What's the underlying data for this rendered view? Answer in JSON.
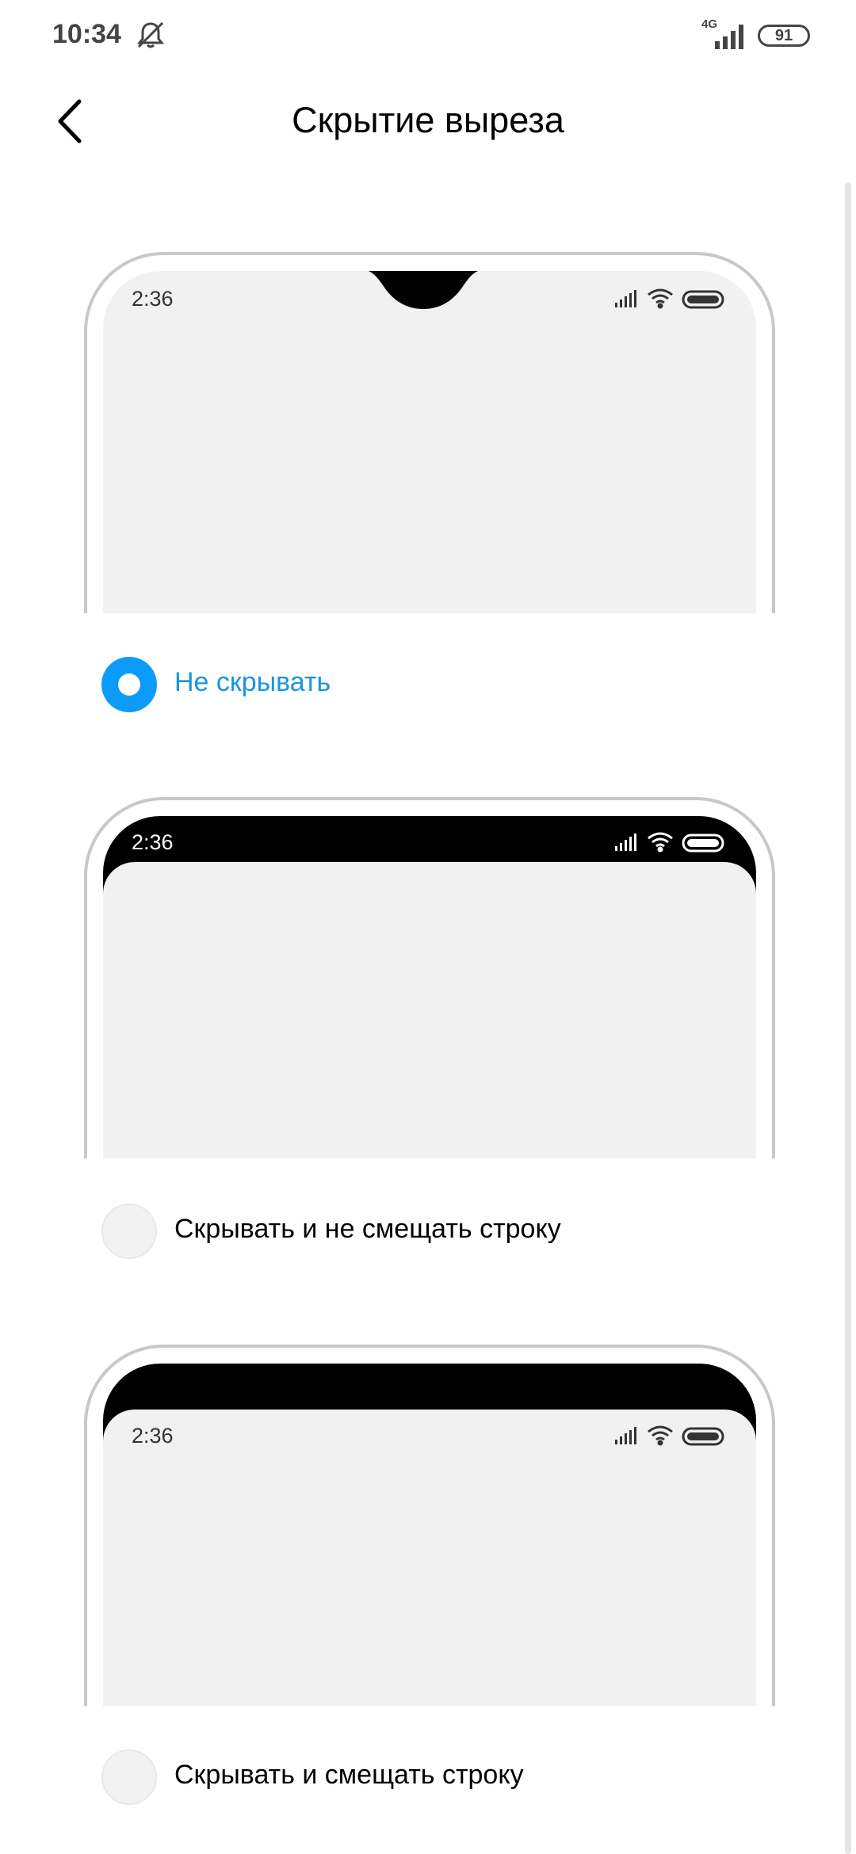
{
  "status_bar": {
    "time": "10:34",
    "network": "4G",
    "battery": "91"
  },
  "header": {
    "title": "Скрытие выреза"
  },
  "options": [
    {
      "label": "Не скрывать",
      "selected": true,
      "preview_time": "2:36"
    },
    {
      "label": "Скрывать и не смещать строку",
      "selected": false,
      "preview_time": "2:36"
    },
    {
      "label": "Скрывать и смещать строку",
      "selected": false,
      "preview_time": "2:36"
    }
  ],
  "colors": {
    "accent": "#0d9bfa",
    "frame": "#c8c8c8",
    "screen": "#f1f1f1"
  },
  "icons": {
    "back": "chevron-left-icon",
    "mute": "bell-off-icon",
    "signal": "signal-icon",
    "wifi": "wifi-icon",
    "battery": "battery-icon"
  }
}
